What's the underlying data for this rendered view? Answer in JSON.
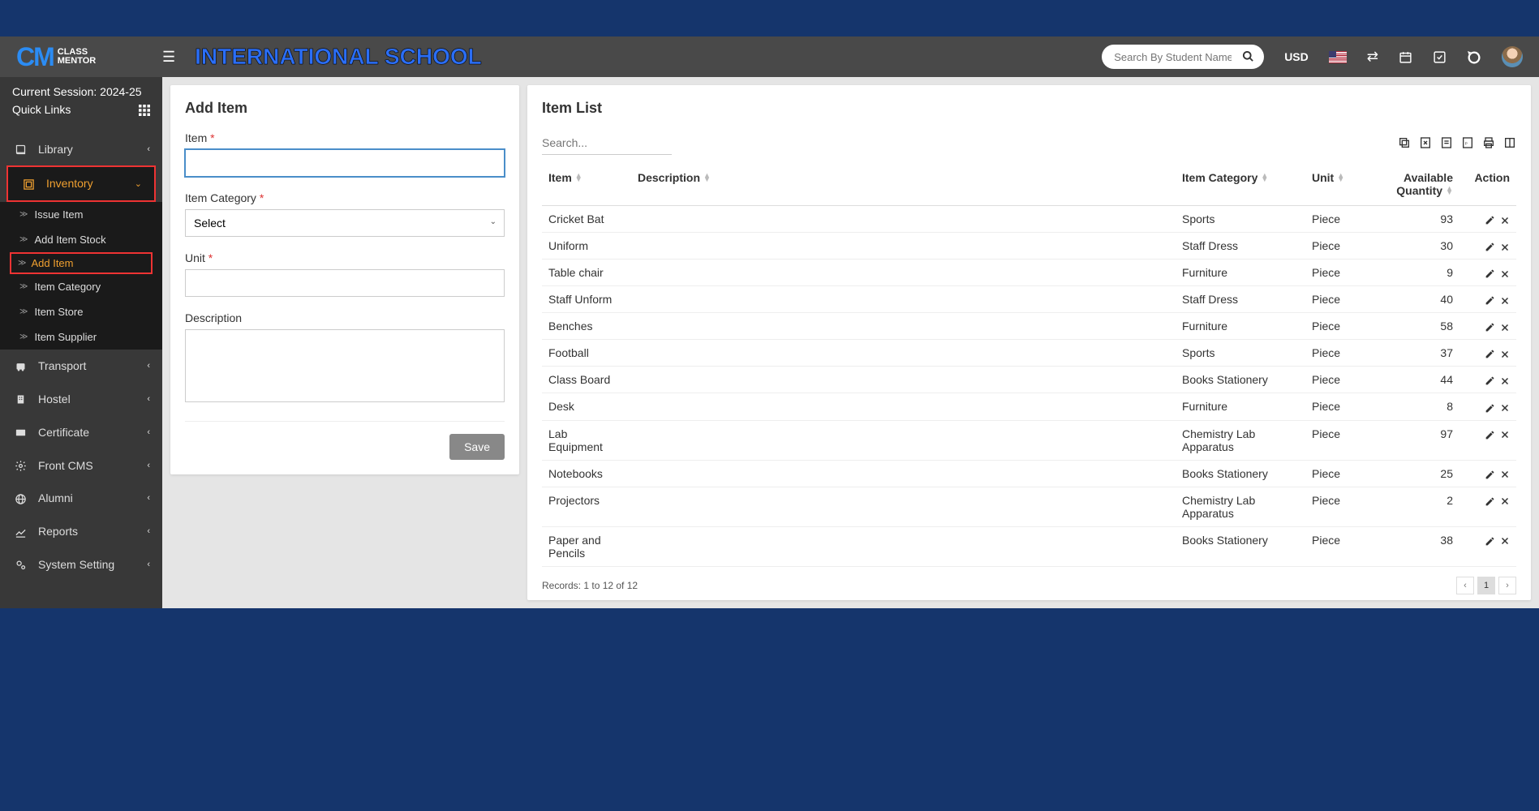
{
  "header": {
    "school_name": "INTERNATIONAL SCHOOL",
    "search_placeholder": "Search By Student Name",
    "currency": "USD"
  },
  "session": {
    "label": "Current Session: 2024-25",
    "quick_links": "Quick Links"
  },
  "sidebar": {
    "items": [
      {
        "label": "Library",
        "icon": "book"
      },
      {
        "label": "Inventory",
        "icon": "inventory",
        "expanded": true
      },
      {
        "label": "Transport",
        "icon": "bus"
      },
      {
        "label": "Hostel",
        "icon": "building"
      },
      {
        "label": "Certificate",
        "icon": "card"
      },
      {
        "label": "Front CMS",
        "icon": "gear"
      },
      {
        "label": "Alumni",
        "icon": "globe"
      },
      {
        "label": "Reports",
        "icon": "chart"
      },
      {
        "label": "System Setting",
        "icon": "cogs"
      }
    ],
    "inventory_sub": [
      {
        "label": "Issue Item"
      },
      {
        "label": "Add Item Stock"
      },
      {
        "label": "Add Item"
      },
      {
        "label": "Item Category"
      },
      {
        "label": "Item Store"
      },
      {
        "label": "Item Supplier"
      }
    ]
  },
  "form": {
    "title": "Add Item",
    "item_label": "Item",
    "category_label": "Item Category",
    "category_placeholder": "Select",
    "unit_label": "Unit",
    "description_label": "Description",
    "save_btn": "Save"
  },
  "list": {
    "title": "Item List",
    "search_placeholder": "Search...",
    "columns": {
      "item": "Item",
      "description": "Description",
      "category": "Item Category",
      "unit": "Unit",
      "quantity": "Available Quantity",
      "action": "Action"
    },
    "rows": [
      {
        "item": "Cricket Bat",
        "desc": "",
        "category": "Sports",
        "unit": "Piece",
        "qty": "93"
      },
      {
        "item": "Uniform",
        "desc": "",
        "category": "Staff Dress",
        "unit": "Piece",
        "qty": "30"
      },
      {
        "item": "Table chair",
        "desc": "",
        "category": "Furniture",
        "unit": "Piece",
        "qty": "9"
      },
      {
        "item": "Staff Unform",
        "desc": "",
        "category": "Staff Dress",
        "unit": "Piece",
        "qty": "40"
      },
      {
        "item": "Benches",
        "desc": "",
        "category": "Furniture",
        "unit": "Piece",
        "qty": "58"
      },
      {
        "item": "Football",
        "desc": "",
        "category": "Sports",
        "unit": "Piece",
        "qty": "37"
      },
      {
        "item": "Class Board",
        "desc": "",
        "category": "Books Stationery",
        "unit": "Piece",
        "qty": "44"
      },
      {
        "item": "Desk",
        "desc": "",
        "category": "Furniture",
        "unit": "Piece",
        "qty": "8"
      },
      {
        "item": "Lab Equipment",
        "desc": "",
        "category": "Chemistry Lab Apparatus",
        "unit": "Piece",
        "qty": "97"
      },
      {
        "item": "Notebooks",
        "desc": "",
        "category": "Books Stationery",
        "unit": "Piece",
        "qty": "25"
      },
      {
        "item": "Projectors",
        "desc": "",
        "category": "Chemistry Lab Apparatus",
        "unit": "Piece",
        "qty": "2"
      },
      {
        "item": "Paper and Pencils",
        "desc": "",
        "category": "Books Stationery",
        "unit": "Piece",
        "qty": "38"
      }
    ],
    "records_label": "Records: 1 to 12 of 12",
    "page": "1"
  }
}
